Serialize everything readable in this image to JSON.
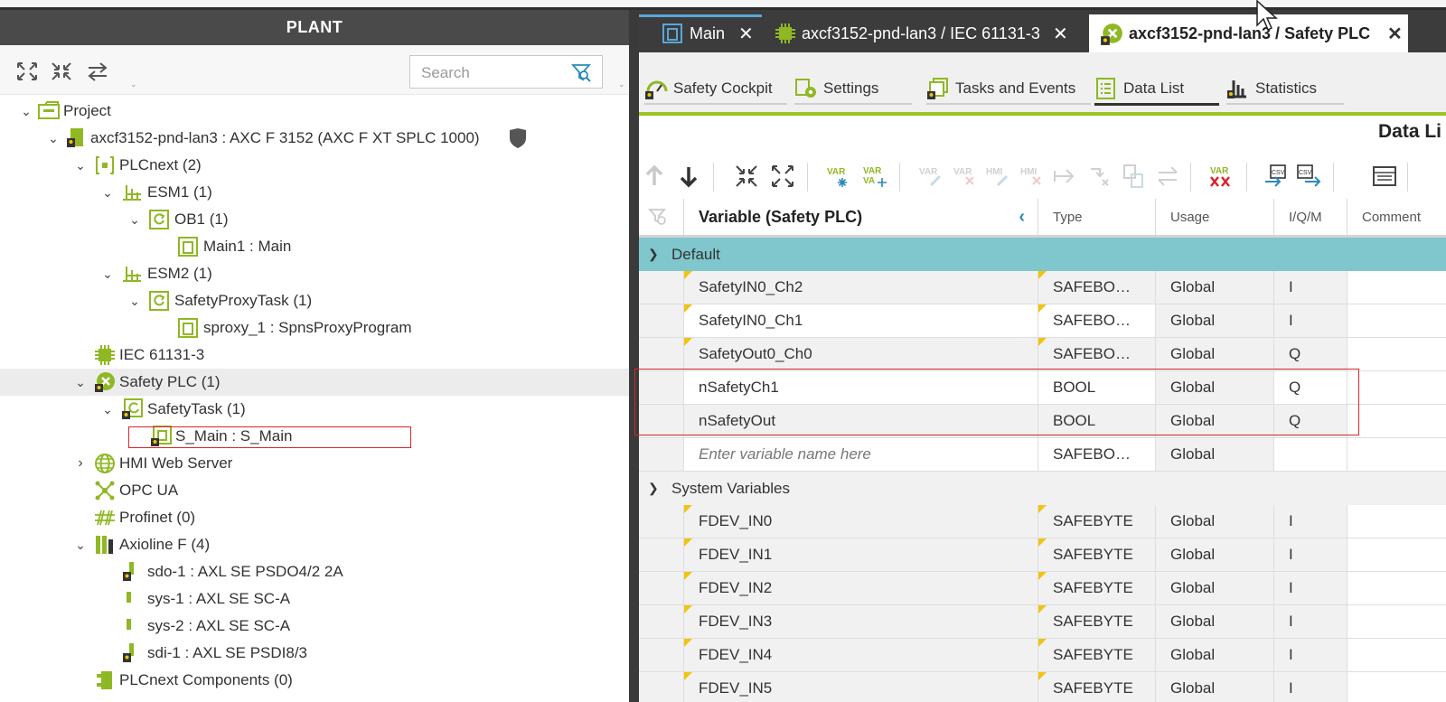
{
  "left_panel": {
    "title": "PLANT",
    "search": {
      "placeholder": "Search",
      "value": ""
    },
    "toolbar_icons": [
      "expand-all-icon",
      "collapse-all-icon",
      "sync-icon"
    ],
    "tree": [
      {
        "label": "Project",
        "icon": "project-icon",
        "expanded": true
      },
      {
        "label": "axcf3152-pnd-lan3 : AXC F 3152 (AXC F XT SPLC 1000)",
        "icon": "controller-icon",
        "expanded": true
      },
      {
        "label": "PLCnext (2)",
        "icon": "plcnext-icon",
        "expanded": true
      },
      {
        "label": "ESM1 (1)",
        "icon": "esm-icon",
        "expanded": true
      },
      {
        "label": "OB1 (1)",
        "icon": "task-icon",
        "expanded": true
      },
      {
        "label": "Main1 : Main",
        "icon": "program-icon"
      },
      {
        "label": "ESM2 (1)",
        "icon": "esm-icon",
        "expanded": true
      },
      {
        "label": "SafetyProxyTask (1)",
        "icon": "task-icon",
        "expanded": true
      },
      {
        "label": "sproxy_1 : SpnsProxyProgram",
        "icon": "program-icon"
      },
      {
        "label": "IEC 61131-3",
        "icon": "chip-icon"
      },
      {
        "label": "Safety PLC (1)",
        "icon": "safety-plc-icon",
        "expanded": true
      },
      {
        "label": "SafetyTask (1)",
        "icon": "safety-task-icon",
        "expanded": true
      },
      {
        "label": "S_Main : S_Main",
        "icon": "safety-program-icon"
      },
      {
        "label": "HMI Web Server",
        "icon": "globe-icon",
        "expanded": false
      },
      {
        "label": "OPC UA",
        "icon": "opcua-icon"
      },
      {
        "label": "Profinet (0)",
        "icon": "profinet-icon"
      },
      {
        "label": "Axioline F (4)",
        "icon": "axioline-icon",
        "expanded": true
      },
      {
        "label": "sdo-1 : AXL SE PSDO4/2 2A",
        "icon": "safety-module-icon"
      },
      {
        "label": "sys-1 : AXL SE SC-A",
        "icon": "module-icon"
      },
      {
        "label": "sys-2 : AXL SE SC-A",
        "icon": "module-icon"
      },
      {
        "label": "sdi-1 : AXL SE PSDI8/3",
        "icon": "safety-module-icon"
      },
      {
        "label": "PLCnext Components (0)",
        "icon": "components-icon"
      }
    ]
  },
  "doc_tabs": [
    {
      "label": "Main",
      "icon": "main-icon",
      "close": "✕"
    },
    {
      "label": "axcf3152-pnd-lan3 / IEC 61131-3",
      "icon": "chip-icon",
      "close": "✕"
    },
    {
      "label": "axcf3152-pnd-lan3 / Safety PLC",
      "icon": "safety-plc-icon",
      "close": "✕",
      "active": true
    }
  ],
  "editor_tabs": [
    {
      "label": "Safety Cockpit",
      "icon": "cockpit-icon"
    },
    {
      "label": "Settings",
      "icon": "settings-icon"
    },
    {
      "label": "Tasks and Events",
      "icon": "tasks-icon"
    },
    {
      "label": "Data List",
      "icon": "datalist-icon",
      "active": true
    },
    {
      "label": "Statistics",
      "icon": "statistics-icon"
    }
  ],
  "data_list_title": "Data Li",
  "grid": {
    "headers": {
      "variable": "Variable (Safety PLC)",
      "type": "Type",
      "usage": "Usage",
      "iqm": "I/Q/M",
      "comment": "Comment"
    },
    "groups": {
      "default": "Default",
      "system": "System Variables"
    },
    "default_rows": [
      {
        "name": "SafetyIN0_Ch2",
        "type": "SAFEBO…",
        "usage": "Global",
        "iqm": "I"
      },
      {
        "name": "SafetyIN0_Ch1",
        "type": "SAFEBO…",
        "usage": "Global",
        "iqm": "I"
      },
      {
        "name": "SafetyOut0_Ch0",
        "type": "SAFEBO…",
        "usage": "Global",
        "iqm": "Q"
      },
      {
        "name": "nSafetyCh1",
        "type": "BOOL",
        "usage": "Global",
        "iqm": "Q"
      },
      {
        "name": "nSafetyOut",
        "type": "BOOL",
        "usage": "Global",
        "iqm": "Q"
      }
    ],
    "new_row": {
      "placeholder": "Enter variable name here",
      "type": "SAFEBO…",
      "usage": "Global"
    },
    "system_rows": [
      {
        "name": "FDEV_IN0",
        "type": "SAFEBYTE",
        "usage": "Global",
        "iqm": "I"
      },
      {
        "name": "FDEV_IN1",
        "type": "SAFEBYTE",
        "usage": "Global",
        "iqm": "I"
      },
      {
        "name": "FDEV_IN2",
        "type": "SAFEBYTE",
        "usage": "Global",
        "iqm": "I"
      },
      {
        "name": "FDEV_IN3",
        "type": "SAFEBYTE",
        "usage": "Global",
        "iqm": "I"
      },
      {
        "name": "FDEV_IN4",
        "type": "SAFEBYTE",
        "usage": "Global",
        "iqm": "I"
      },
      {
        "name": "FDEV_IN5",
        "type": "SAFEBYTE",
        "usage": "Global",
        "iqm": "I"
      }
    ]
  },
  "colors": {
    "accent_green": "#9ac424",
    "group_teal": "#7fc7cc",
    "highlight_red": "#d7262b",
    "header_dark": "#4a4a4a",
    "flag_yellow": "#f2c40f"
  }
}
